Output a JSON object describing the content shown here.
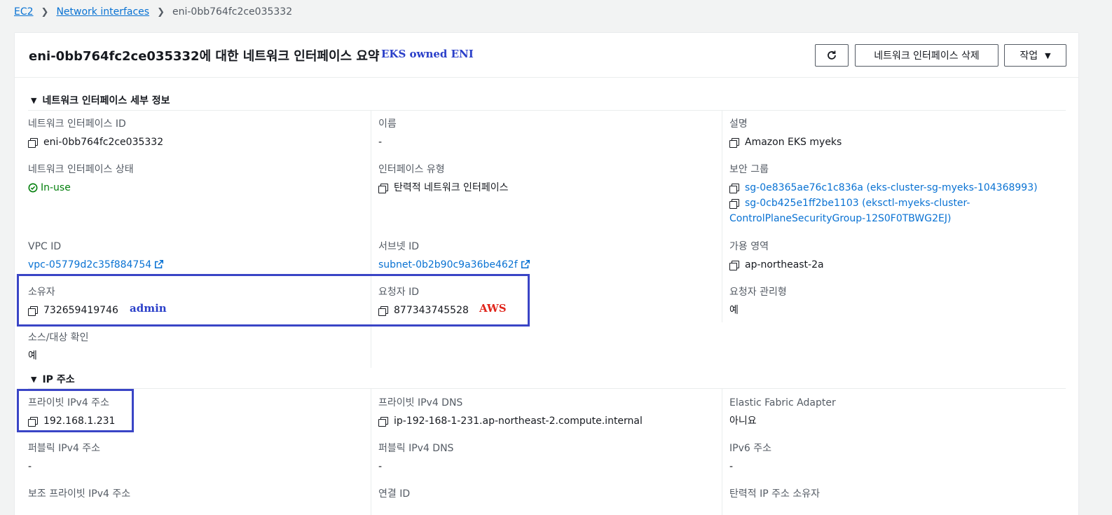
{
  "breadcrumb": {
    "root": "EC2",
    "parent": "Network interfaces",
    "current": "eni-0bb764fc2ce035332"
  },
  "header": {
    "title": "eni-0bb764fc2ce035332에 대한 네트워크 인터페이스 요약",
    "annotation": "EKS owned ENI",
    "delete_label": "네트워크 인터페이스 삭제",
    "actions_label": "작업",
    "refresh_icon": "refresh-icon"
  },
  "details": {
    "section_title": "네트워크 인터페이스 세부 정보",
    "eni_id_label": "네트워크 인터페이스 ID",
    "eni_id": "eni-0bb764fc2ce035332",
    "name_label": "이름",
    "name": "-",
    "description_label": "설명",
    "description": "Amazon EKS myeks",
    "status_label": "네트워크 인터페이스 상태",
    "status": "In-use",
    "type_label": "인터페이스 유형",
    "type": "탄력적 네트워크 인터페이스",
    "sg_label": "보안 그룹",
    "sg1": "sg-0e8365ae76c1c836a (eks-cluster-sg-myeks-104368993)",
    "sg2_line1": "sg-0cb425e1ff2be1103 (eksctl-myeks-cluster-",
    "sg2_line2": "ControlPlaneSecurityGroup-12S0F0TBWG2EJ)",
    "vpc_label": "VPC ID",
    "vpc": "vpc-05779d2c35f884754",
    "subnet_label": "서브넷 ID",
    "subnet": "subnet-0b2b90c9a36be462f",
    "az_label": "가용 영역",
    "az": "ap-northeast-2a",
    "owner_label": "소유자",
    "owner": "732659419746",
    "owner_annotation": "admin",
    "requester_label": "요청자 ID",
    "requester": "877343745528",
    "requester_annotation": "AWS",
    "managed_label": "요청자 관리형",
    "managed": "예",
    "srcdst_label": "소스/대상 확인",
    "srcdst": "예"
  },
  "ip": {
    "section_title": "IP 주소",
    "private_ipv4_label": "프라이빗 IPv4 주소",
    "private_ipv4": "192.168.1.231",
    "private_dns_label": "프라이빗 IPv4 DNS",
    "private_dns": "ip-192-168-1-231.ap-northeast-2.compute.internal",
    "efa_label": "Elastic Fabric Adapter",
    "efa": "아니요",
    "public_ipv4_label": "퍼블릭 IPv4 주소",
    "public_ipv4": "-",
    "public_dns_label": "퍼블릭 IPv4 DNS",
    "public_dns": "-",
    "ipv6_label": "IPv6 주소",
    "ipv6": "-",
    "secondary_label": "보조 프라이빗 IPv4 주소",
    "association_label": "연결 ID",
    "eip_owner_label": "탄력적 IP 주소 소유자"
  },
  "colors": {
    "link": "#0972d3",
    "success": "#037f0c",
    "annotation_box": "#3a45c6",
    "annotation_red": "#e0251b"
  }
}
